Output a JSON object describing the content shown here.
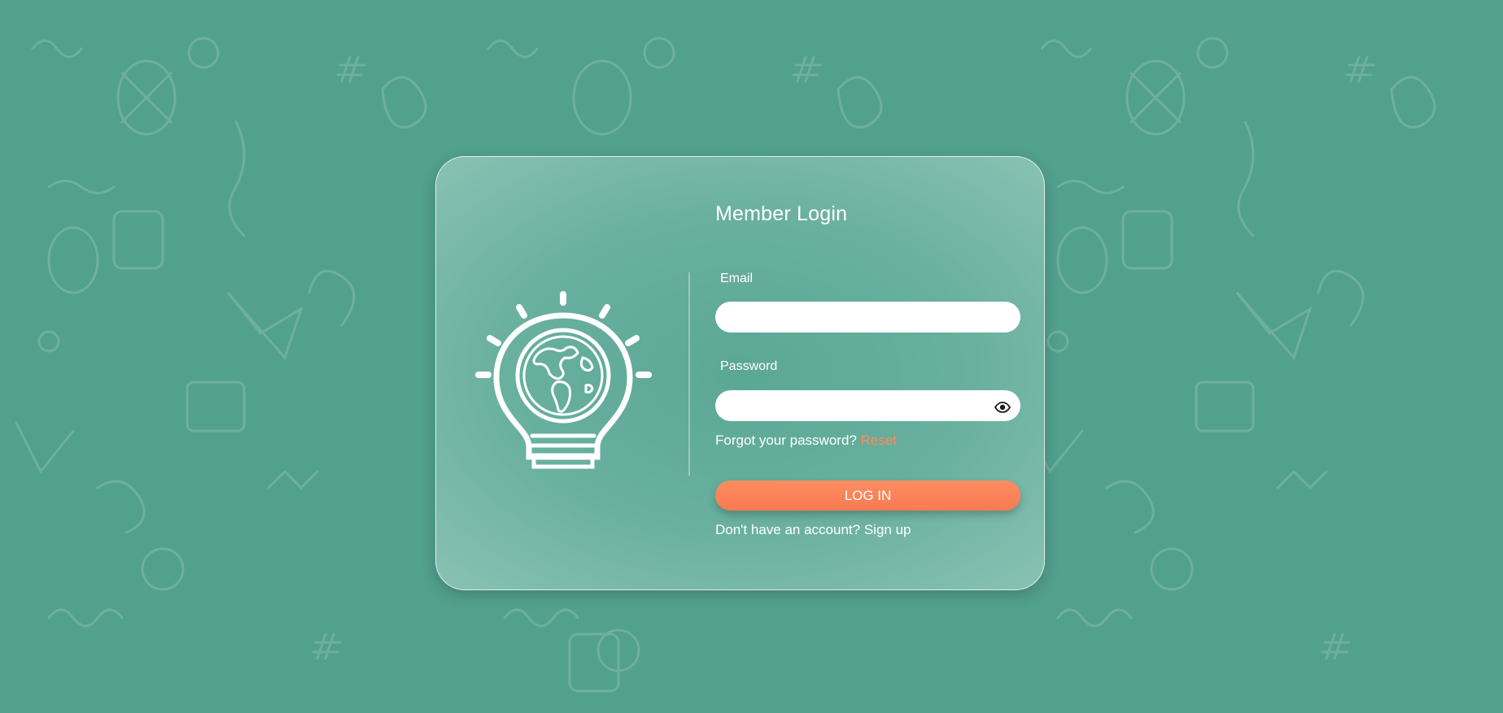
{
  "login": {
    "title": "Member Login",
    "email_label": "Email",
    "email_value": "",
    "password_label": "Password",
    "password_value": "",
    "forgot_text": "Forgot your password?",
    "reset_link": "Reset",
    "login_button": "LOG IN",
    "signup_text": "Don't have an account?",
    "signup_link": "Sign up"
  },
  "icons": {
    "logo": "lightbulb-globe-icon",
    "password_toggle": "eye-icon"
  },
  "colors": {
    "background": "#52a08e",
    "accent": "#ff8a5c",
    "text": "#ffffff"
  }
}
